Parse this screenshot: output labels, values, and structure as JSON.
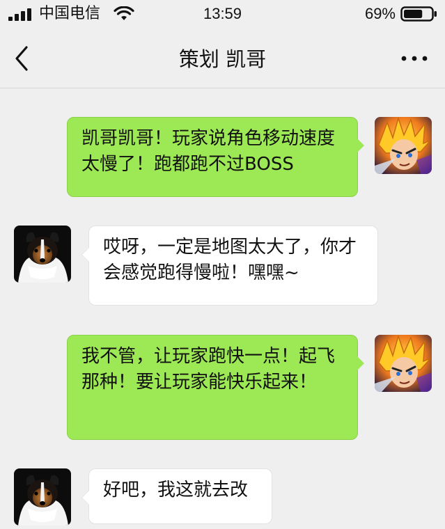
{
  "status_bar": {
    "carrier": "中国电信",
    "time": "13:59",
    "battery_percent": "69%",
    "battery_level": 0.69,
    "icons": [
      "signal-icon",
      "wifi-icon",
      "battery-icon"
    ]
  },
  "nav": {
    "title": "策划 凯哥",
    "back_icon": "chevron-left-icon",
    "more_icon": "more-horizontal-icon"
  },
  "messages": [
    {
      "direction": "out",
      "sender": "me",
      "avatar": "anime-hero-avatar",
      "text": "凯哥凯哥！玩家说角色移动速度太慢了！跑都跑不过BOSS"
    },
    {
      "direction": "in",
      "sender": "策划 凯哥",
      "avatar": "dog-avatar",
      "text": "哎呀，一定是地图太大了，你才会感觉跑得慢啦！嘿嘿~"
    },
    {
      "direction": "out",
      "sender": "me",
      "avatar": "anime-hero-avatar",
      "text": "我不管，让玩家跑快一点！起飞那种！要让玩家能快乐起来！"
    },
    {
      "direction": "in",
      "sender": "策划 凯哥",
      "avatar": "dog-avatar",
      "text": "好吧，我这就去改"
    }
  ],
  "colors": {
    "background": "#efefef",
    "outgoing_bubble": "#9de855",
    "incoming_bubble": "#ffffff"
  }
}
